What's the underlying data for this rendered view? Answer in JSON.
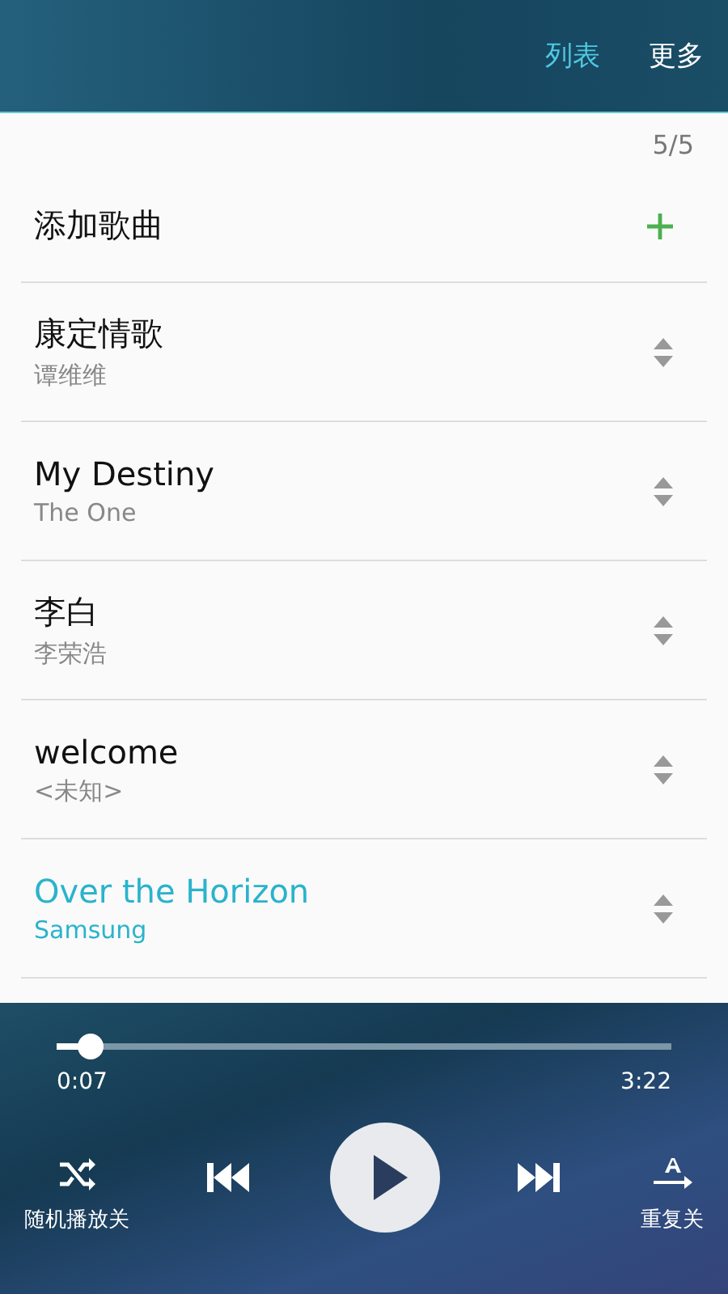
{
  "tabs": [
    {
      "label": "列表",
      "selected": true
    },
    {
      "label": "更多",
      "selected": false
    }
  ],
  "count": "5/5",
  "add_song": {
    "label": "添加歌曲"
  },
  "songs": [
    {
      "title": "康定情歌",
      "artist": "谭维维",
      "selected": false
    },
    {
      "title": "My Destiny",
      "artist": "The One",
      "selected": false
    },
    {
      "title": "李白",
      "artist": "李荣浩",
      "selected": false
    },
    {
      "title": "welcome",
      "artist": "<未知>",
      "selected": false
    },
    {
      "title": "Over the Horizon",
      "artist": "Samsung",
      "selected": true
    }
  ],
  "player": {
    "level": 0.037,
    "elapsed": "0:07",
    "duration": "3:22",
    "shuffle_label": "随机播放关",
    "repeat_label": "重复关"
  }
}
